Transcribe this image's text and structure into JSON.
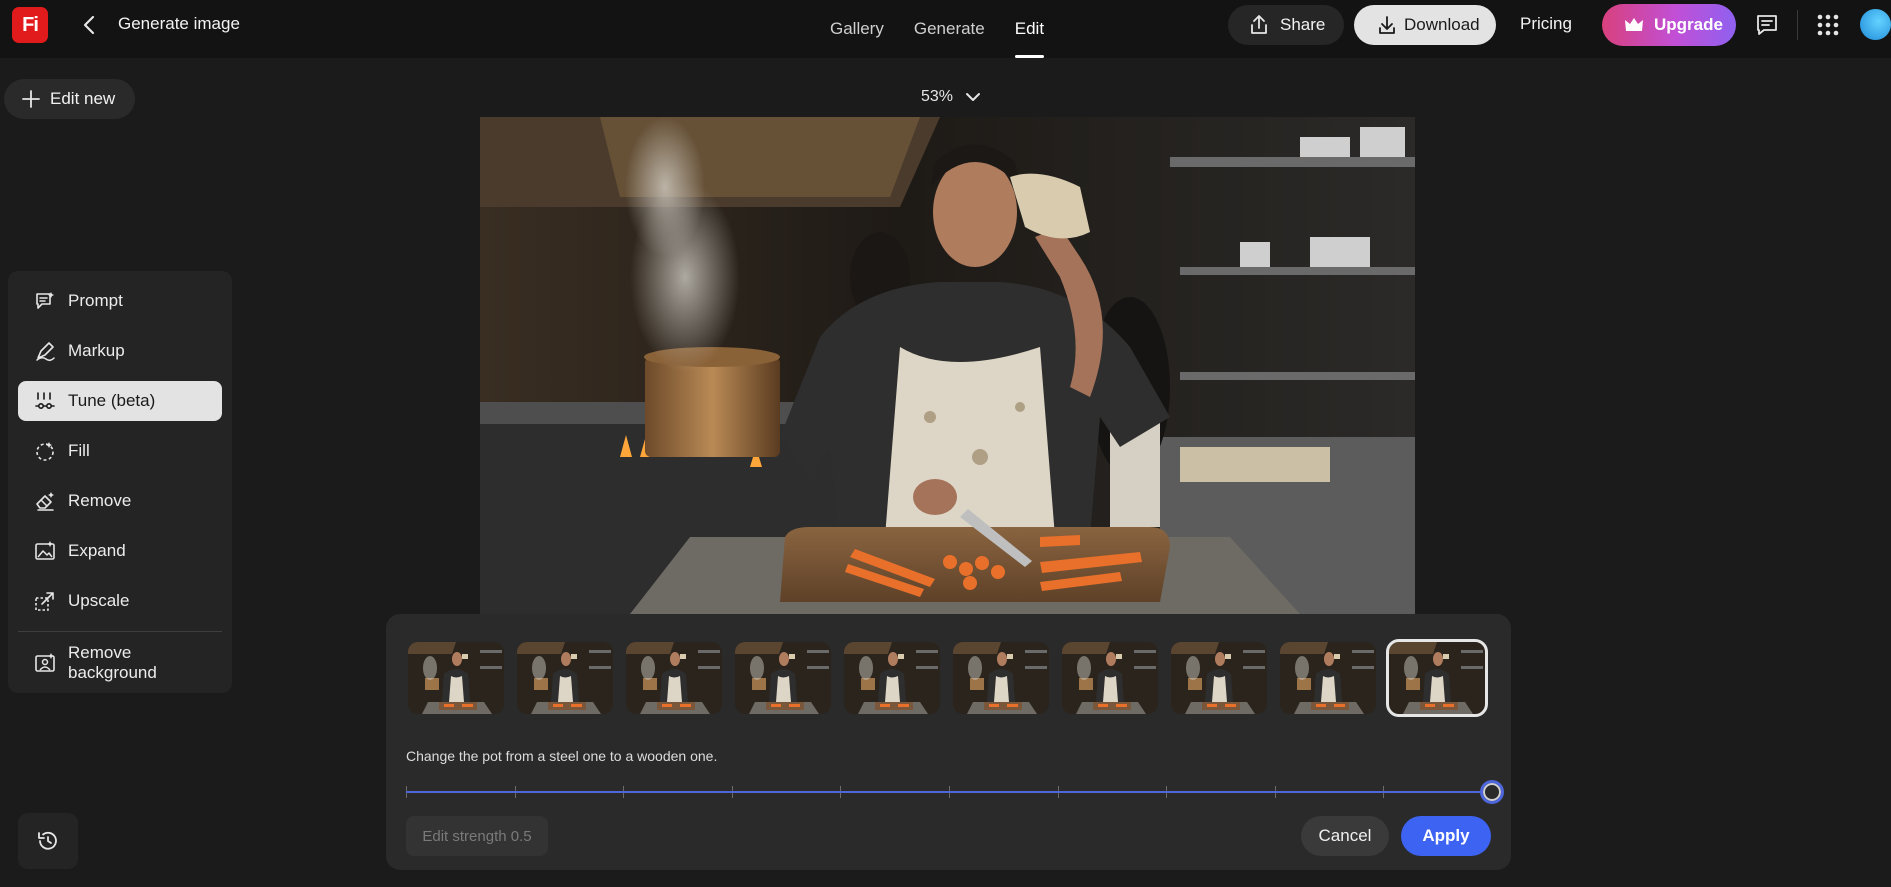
{
  "header": {
    "logo_text": "Fi",
    "title": "Generate image",
    "tabs": [
      {
        "label": "Gallery",
        "active": false
      },
      {
        "label": "Generate",
        "active": false
      },
      {
        "label": "Edit",
        "active": true
      }
    ],
    "share_label": "Share",
    "download_label": "Download",
    "pricing_label": "Pricing",
    "upgrade_label": "Upgrade"
  },
  "toolbar": {
    "edit_new_label": "Edit new",
    "zoom_label": "53%"
  },
  "tools": [
    {
      "label": "Prompt",
      "icon": "prompt-icon",
      "active": false
    },
    {
      "label": "Markup",
      "icon": "markup-icon",
      "active": false
    },
    {
      "label": "Tune (beta)",
      "icon": "tune-icon",
      "active": true
    },
    {
      "label": "Fill",
      "icon": "fill-icon",
      "active": false
    },
    {
      "label": "Remove",
      "icon": "remove-icon",
      "active": false
    },
    {
      "label": "Expand",
      "icon": "expand-icon",
      "active": false
    },
    {
      "label": "Upscale",
      "icon": "upscale-icon",
      "active": false
    },
    {
      "label": "Remove background",
      "icon": "remove-background-icon",
      "active": false
    }
  ],
  "tune_panel": {
    "thumbnail_count": 10,
    "selected_thumbnail": 10,
    "prompt": "Change the pot from a steel one to a wooden one.",
    "slider_value": 1.0,
    "slider_steps": 10,
    "strength_label": "Edit strength 0.5",
    "cancel_label": "Cancel",
    "apply_label": "Apply"
  },
  "colors": {
    "accent": "#3d63f2",
    "brand": "#e11b1b",
    "background": "#1b1b1b",
    "panel": "#2a2a2a"
  }
}
